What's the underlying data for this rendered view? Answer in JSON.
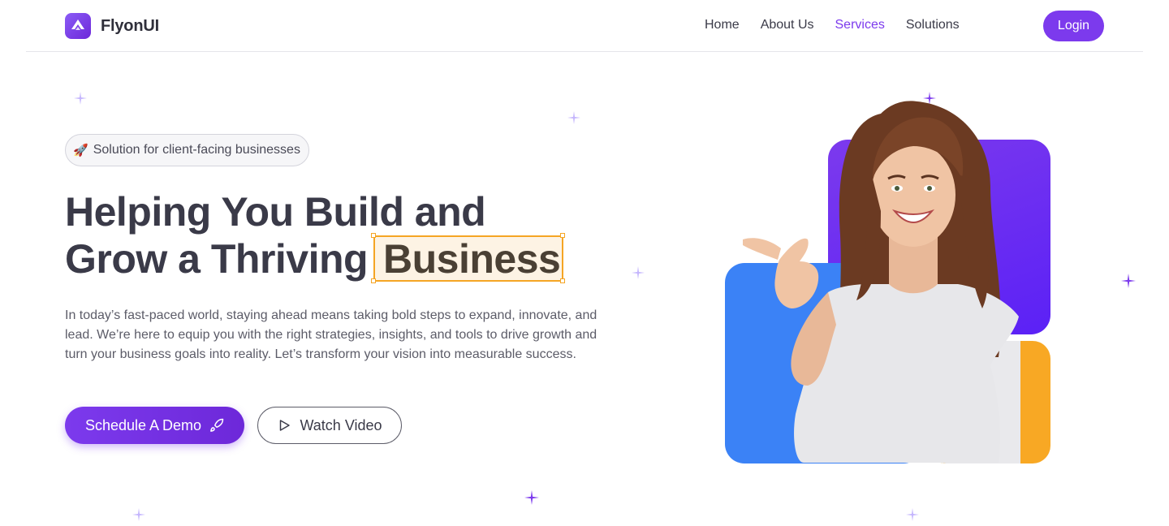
{
  "brand": {
    "name": "FlyonUI",
    "logo_icon": "flyonui-logo-icon",
    "accent": "#7c3aed"
  },
  "nav": {
    "links": [
      {
        "label": "Home",
        "active": false
      },
      {
        "label": "About Us",
        "active": false
      },
      {
        "label": "Services",
        "active": true
      },
      {
        "label": "Solutions",
        "active": false
      }
    ],
    "login_label": "Login"
  },
  "hero": {
    "badge": {
      "icon": "🚀",
      "text": "Solution for client-facing businesses"
    },
    "headline_line1": "Helping You Build and",
    "headline_line2": "Grow a Thriving",
    "headline_highlight": "Business",
    "description": "In today’s fast-paced world, staying ahead means taking bold steps to expand, innovate, and lead. We’re here to equip you with the right strategies, insights, and tools to drive growth and turn your business goals into reality. Let’s transform your vision into measurable success.",
    "primary_cta": "Schedule A Demo",
    "primary_cta_icon": "rocket-icon",
    "secondary_cta": "Watch Video",
    "secondary_cta_icon": "play-icon"
  },
  "colors": {
    "purple": "#7c3aed",
    "blue": "#3b82f6",
    "orange": "#f8a824",
    "highlight_border": "#f5a524",
    "highlight_fill": "#fdf3e4"
  }
}
